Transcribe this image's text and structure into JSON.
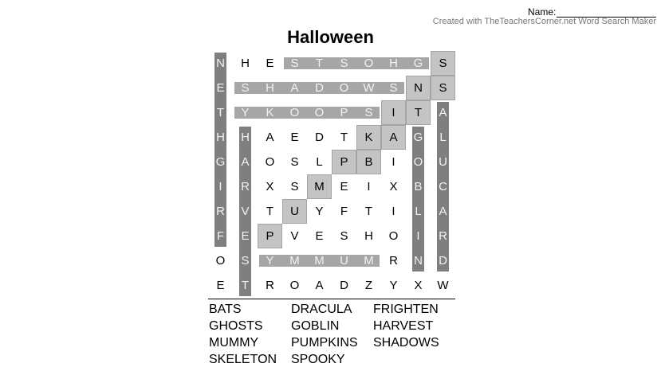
{
  "header": {
    "name_label": "Name:",
    "credit": "Created with TheTeachersCorner.net Word Search Maker"
  },
  "puzzle": {
    "title": "Halloween",
    "grid": [
      [
        "N",
        "H",
        "E",
        "S",
        "T",
        "S",
        "O",
        "H",
        "G",
        "S"
      ],
      [
        "E",
        "S",
        "H",
        "A",
        "D",
        "O",
        "W",
        "S",
        "N",
        "S"
      ],
      [
        "T",
        "Y",
        "K",
        "O",
        "O",
        "P",
        "S",
        "I",
        "T",
        "A"
      ],
      [
        "H",
        "H",
        "A",
        "E",
        "D",
        "T",
        "K",
        "A",
        "G",
        "L"
      ],
      [
        "G",
        "A",
        "O",
        "S",
        "L",
        "P",
        "B",
        "I",
        "O",
        "U"
      ],
      [
        "I",
        "R",
        "X",
        "S",
        "M",
        "E",
        "I",
        "X",
        "B",
        "C"
      ],
      [
        "R",
        "V",
        "T",
        "U",
        "Y",
        "F",
        "T",
        "I",
        "L",
        "A"
      ],
      [
        "F",
        "E",
        "P",
        "V",
        "E",
        "S",
        "H",
        "O",
        "I",
        "R"
      ],
      [
        "O",
        "S",
        "Y",
        "M",
        "M",
        "U",
        "M",
        "R",
        "N",
        "D"
      ],
      [
        "E",
        "T",
        "R",
        "O",
        "A",
        "D",
        "Z",
        "Y",
        "X",
        "W"
      ]
    ],
    "found_words": [
      {
        "word": "GHOSTS",
        "start": [
          0,
          8
        ],
        "end": [
          0,
          3
        ],
        "style": "horizontal-bar"
      },
      {
        "word": "SHADOWS",
        "start": [
          1,
          1
        ],
        "end": [
          1,
          7
        ],
        "style": "horizontal-bar"
      },
      {
        "word": "SPOOKY",
        "start": [
          2,
          6
        ],
        "end": [
          2,
          1
        ],
        "style": "horizontal-bar"
      },
      {
        "word": "MUMMY",
        "start": [
          8,
          6
        ],
        "end": [
          8,
          2
        ],
        "style": "horizontal-bar"
      },
      {
        "word": "FRIGHTEN",
        "start": [
          7,
          0
        ],
        "end": [
          0,
          0
        ],
        "style": "vertical-bar"
      },
      {
        "word": "HARVEST",
        "start": [
          3,
          1
        ],
        "end": [
          9,
          1
        ],
        "style": "vertical-bar"
      },
      {
        "word": "GOBLIN",
        "start": [
          3,
          8
        ],
        "end": [
          8,
          8
        ],
        "style": "vertical-bar"
      },
      {
        "word": "DRACULA",
        "start": [
          8,
          9
        ],
        "end": [
          2,
          9
        ],
        "style": "vertical-bar"
      },
      {
        "word": "SKELETON",
        "start": [
          0,
          9
        ],
        "end": [
          7,
          2
        ],
        "style": "diagonal-boxes"
      },
      {
        "word": "PUMPKINS",
        "start": [
          7,
          2
        ],
        "end": [
          0,
          9
        ],
        "style": "diagonal-boxes"
      },
      {
        "word": "BATS",
        "start": [
          4,
          6
        ],
        "end": [
          1,
          9
        ],
        "style": "diagonal-boxes"
      }
    ],
    "word_list": [
      "BATS",
      "DRACULA",
      "FRIGHTEN",
      "GHOSTS",
      "GOBLIN",
      "HARVEST",
      "MUMMY",
      "PUMPKINS",
      "SHADOWS",
      "SKELETON",
      "SPOOKY"
    ]
  },
  "colors": {
    "bar_horizontal": "#a6a6a6",
    "bar_vertical": "#7f7f7f",
    "box_fill": "#c4c4c4",
    "letter_on_bar": "#f2f2f2",
    "letter_plain": "#000000"
  }
}
